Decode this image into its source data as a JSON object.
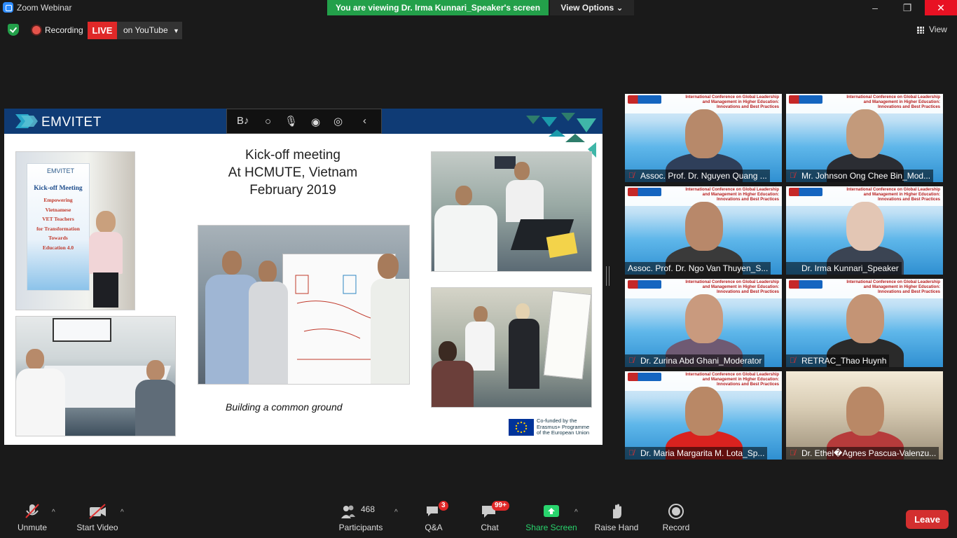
{
  "window": {
    "title": "Zoom Webinar",
    "viewing_banner": "You are viewing Dr. Irma Kunnari_Speaker's screen",
    "view_options": "View Options",
    "minimize": "–",
    "maximize": "❐",
    "close": "✕"
  },
  "status": {
    "recording": "Recording",
    "live": "LIVE",
    "destination": "on YouTube",
    "view": "View"
  },
  "slide": {
    "brand": "EMVITET",
    "title_lines": [
      "Kick-off meeting",
      "At HCMUTE, Vietnam",
      "February 2019"
    ],
    "caption": "Building a common ground",
    "banner_title": "Kick-off Meeting",
    "banner_lines": [
      "Empowering",
      "Vietnamese",
      "VET Teachers",
      "for Transformation",
      "Towards",
      "Education 4.0"
    ],
    "banner_brand": "EMVITET",
    "eu_text": [
      "Co-funded by the",
      "Erasmus+ Programme",
      "of the European Union"
    ]
  },
  "gallery": [
    {
      "name": "Assoc. Prof. Dr. Nguyen Quang ...",
      "muted": true,
      "speaking": false
    },
    {
      "name": "Mr. Johnson Ong Chee Bin_Mod...",
      "muted": true,
      "speaking": false
    },
    {
      "name": "Assoc. Prof. Dr. Ngo Van Thuyen_S...",
      "muted": false,
      "speaking": true
    },
    {
      "name": "Dr. Irma Kunnari_Speaker",
      "muted": false,
      "speaking": false
    },
    {
      "name": "Dr. Zurina Abd Ghani_Moderator",
      "muted": true,
      "speaking": false
    },
    {
      "name": "RETRAC_Thao Huynh",
      "muted": true,
      "speaking": false
    },
    {
      "name": "Dr. Maria Margarita M. Lota_Sp...",
      "muted": true,
      "speaking": false
    },
    {
      "name": "Dr. Ethel�Agnes Pascua-Valenzu...",
      "muted": true,
      "speaking": false
    }
  ],
  "tile_conf_text": "International Conference on Global Leadership and Management in Higher Education: Innovations and Best Practices",
  "toolbar": {
    "unmute": "Unmute",
    "start_video": "Start Video",
    "participants": "Participants",
    "participants_count": "468",
    "qa": "Q&A",
    "qa_badge": "3",
    "chat": "Chat",
    "chat_badge": "99+",
    "share_screen": "Share Screen",
    "raise_hand": "Raise Hand",
    "record": "Record",
    "leave": "Leave"
  },
  "colors": {
    "banner_green": "#23a04a",
    "live_red": "#e02828",
    "speaking_border": "#b6e52f",
    "share_green": "#29d46d",
    "slide_header": "#0f3b75"
  }
}
